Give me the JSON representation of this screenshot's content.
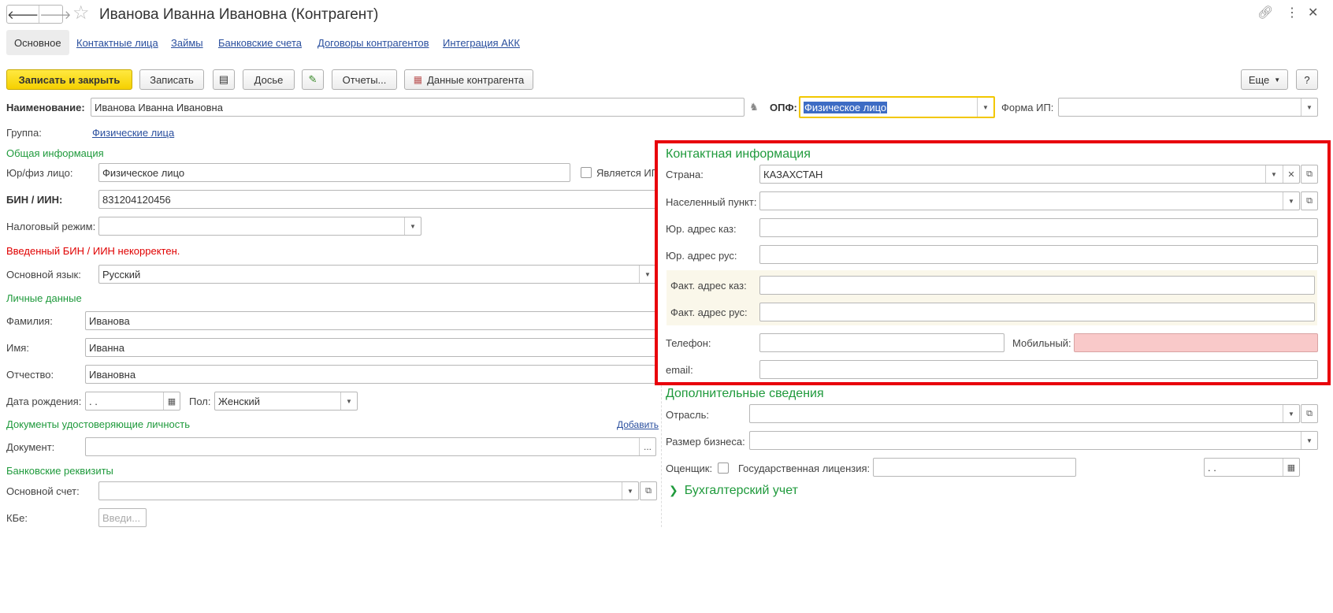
{
  "window": {
    "title": "Иванова Иванна Ивановна (Контрагент)"
  },
  "tabs": [
    "Основное",
    "Контактные лица",
    "Займы",
    "Банковские счета",
    "Договоры контрагентов",
    "Интеграция АКК"
  ],
  "toolbar": {
    "save_close": "Записать и закрыть",
    "save": "Записать",
    "dossier": "Досье",
    "reports": "Отчеты...",
    "counterparty_data": "Данные контрагента",
    "more": "Еще",
    "help": "?"
  },
  "header": {
    "name_label": "Наименование:",
    "name_value": "Иванова Иванна Ивановна",
    "opf_label": "ОПФ:",
    "opf_value": "Физическое лицо",
    "ip_form_label": "Форма ИП:",
    "group_label": "Группа:",
    "group_value": "Физические лица"
  },
  "general": {
    "title": "Общая информация",
    "entity_label": "Юр/физ лицо:",
    "entity_value": "Физическое лицо",
    "is_ip_label": "Является ИП",
    "bin_label": "БИН / ИИН:",
    "bin_value": "831204120456",
    "tax_label": "Налоговый режим:",
    "error": "Введенный БИН / ИИН некорректен.",
    "lang_label": "Основной язык:",
    "lang_value": "Русский"
  },
  "personal": {
    "title": "Личные данные",
    "last_label": "Фамилия:",
    "last_value": "Иванова",
    "first_label": "Имя:",
    "first_value": "Иванна",
    "middle_label": "Отчество:",
    "middle_value": "Ивановна",
    "dob_label": "Дата рождения:",
    "dob_value": " .  .",
    "sex_label": "Пол:",
    "sex_value": "Женский"
  },
  "docs": {
    "title": "Документы удостоверяющие личность",
    "add": "Добавить",
    "doc_label": "Документ:",
    "ellipsis": "..."
  },
  "bank": {
    "title": "Банковские реквизиты",
    "acc_label": "Основной счет:",
    "kbe_label": "КБе:",
    "kbe_placeholder": "Введи..."
  },
  "contact": {
    "title": "Контактная информация",
    "country_label": "Страна:",
    "country_value": "КАЗАХСТАН",
    "locality_label": "Населенный пункт:",
    "legal_kz_label": "Юр. адрес каз:",
    "legal_ru_label": "Юр. адрес рус:",
    "fact_kz_label": "Факт. адрес каз:",
    "fact_ru_label": "Факт. адрес рус:",
    "phone_label": "Телефон:",
    "mobile_label": "Мобильный:",
    "email_label": "email:"
  },
  "extra": {
    "title": "Дополнительные сведения",
    "industry_label": "Отрасль:",
    "size_label": "Размер бизнеса:",
    "appraiser_label": "Оценщик:",
    "license_label": "Государственная лицензия:",
    "license_date": " .  ."
  },
  "accounting": {
    "title": "Бухгалтерский учет"
  },
  "colors": {
    "accent_green": "#1f9a3c",
    "link_blue": "#2a4f9e",
    "highlight_red": "#e8000b",
    "primary_yellow": "#f5d000"
  }
}
